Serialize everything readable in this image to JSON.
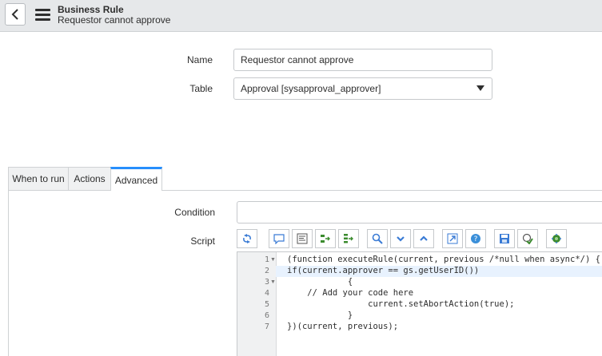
{
  "header": {
    "title": "Business Rule",
    "subtitle": "Requestor cannot approve"
  },
  "form": {
    "name_label": "Name",
    "name_value": "Requestor cannot approve",
    "table_label": "Table",
    "table_value": "Approval [sysapproval_approver]"
  },
  "tabs": [
    {
      "label": "When to run"
    },
    {
      "label": "Actions"
    },
    {
      "label": "Advanced"
    }
  ],
  "advanced": {
    "condition_label": "Condition",
    "condition_value": "",
    "script_label": "Script"
  },
  "toolbar_icons": [
    "toggle-syntax-icon",
    "comment-icon",
    "format-code-icon",
    "replace-icon",
    "replace-all-icon",
    "search-icon",
    "fold-down-icon",
    "fold-up-icon",
    "fullscreen-icon",
    "help-icon",
    "save-icon",
    "check-script-icon",
    "debug-script-icon"
  ],
  "script": {
    "line_numbers": [
      "1",
      "2",
      "3",
      "4",
      "5",
      "6",
      "7"
    ],
    "lines": [
      "(function executeRule(current, previous /*null when async*/) {",
      "if(current.approver == gs.getUserID())",
      "            {",
      "    // Add your code here",
      "                current.setAbortAction(true);",
      "            }",
      "})(current, previous);"
    ]
  }
}
